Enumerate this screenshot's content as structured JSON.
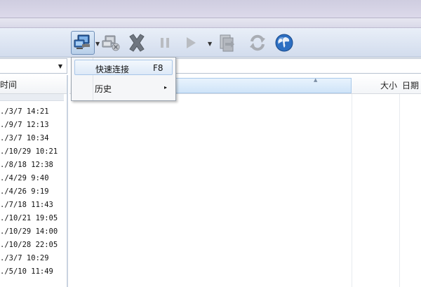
{
  "toolbar": {
    "buttons": [
      {
        "name": "connect",
        "icon": "computer-connect-icon"
      },
      {
        "name": "disconnect",
        "icon": "computer-disconnect-icon"
      },
      {
        "name": "stop",
        "icon": "cross-icon"
      },
      {
        "name": "pause",
        "icon": "pause-icon"
      },
      {
        "name": "play",
        "icon": "play-icon"
      },
      {
        "name": "queue",
        "icon": "document-transfer-icon"
      },
      {
        "name": "refresh",
        "icon": "refresh-icon"
      },
      {
        "name": "web",
        "icon": "globe-icon"
      }
    ]
  },
  "left_pane": {
    "header": "时间",
    "rows": [
      "./3/7 14:21",
      "./9/7 12:13",
      "./3/7 10:34",
      "./10/29 10:21",
      "./8/18 12:38",
      "./4/29 9:40",
      "./4/26 9:19",
      "./7/18 11:43",
      "./10/21 19:05",
      "./10/29 14:00",
      "./10/28 22:05",
      "./3/7 10:29",
      "./5/10 11:49"
    ]
  },
  "right_pane": {
    "columns": {
      "size": "大小",
      "date": "日期"
    }
  },
  "connect_menu": {
    "items": [
      {
        "label": "快速连接",
        "shortcut": "F8"
      },
      {
        "label": "历史",
        "submenu_arrow": "▸"
      }
    ]
  },
  "colors": {
    "toolbar_bg": "#d2dced",
    "highlight": "#cfe4f8",
    "accent_blue": "#2d6fc2"
  }
}
